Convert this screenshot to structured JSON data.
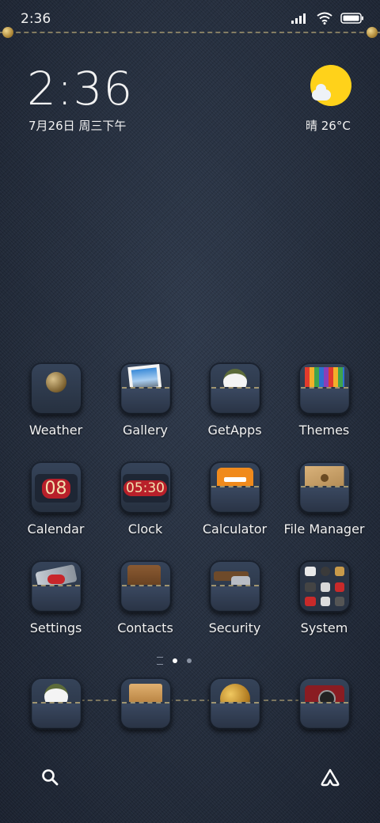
{
  "status_bar": {
    "time": "2:36"
  },
  "widget": {
    "clock": "2:36",
    "date": "7月26日 周三下午",
    "weather_text": "晴 26°C",
    "sun_color": "#ffd21a"
  },
  "apps": [
    {
      "label": "Weather",
      "icon": "weather-icon"
    },
    {
      "label": "Gallery",
      "icon": "gallery-icon"
    },
    {
      "label": "GetApps",
      "icon": "getapps-icon"
    },
    {
      "label": "Themes",
      "icon": "themes-icon"
    },
    {
      "label": "Calendar",
      "icon": "calendar-icon",
      "icon_text": "08"
    },
    {
      "label": "Clock",
      "icon": "clock-icon",
      "icon_text": "05:30"
    },
    {
      "label": "Calculator",
      "icon": "calculator-icon"
    },
    {
      "label": "File Manager",
      "icon": "file-manager-icon"
    },
    {
      "label": "Settings",
      "icon": "settings-icon"
    },
    {
      "label": "Contacts",
      "icon": "contacts-icon"
    },
    {
      "label": "Security",
      "icon": "security-icon"
    },
    {
      "label": "System",
      "icon": "system-icon"
    }
  ],
  "dock": [
    {
      "icon": "mi-bunny-icon"
    },
    {
      "icon": "messages-icon"
    },
    {
      "icon": "browser-globe-icon"
    },
    {
      "icon": "camera-icon"
    }
  ],
  "page_indicator": {
    "pages": 2,
    "current": 1
  },
  "colors": {
    "denim": "#232c3b",
    "stitch": "#d2be82"
  }
}
